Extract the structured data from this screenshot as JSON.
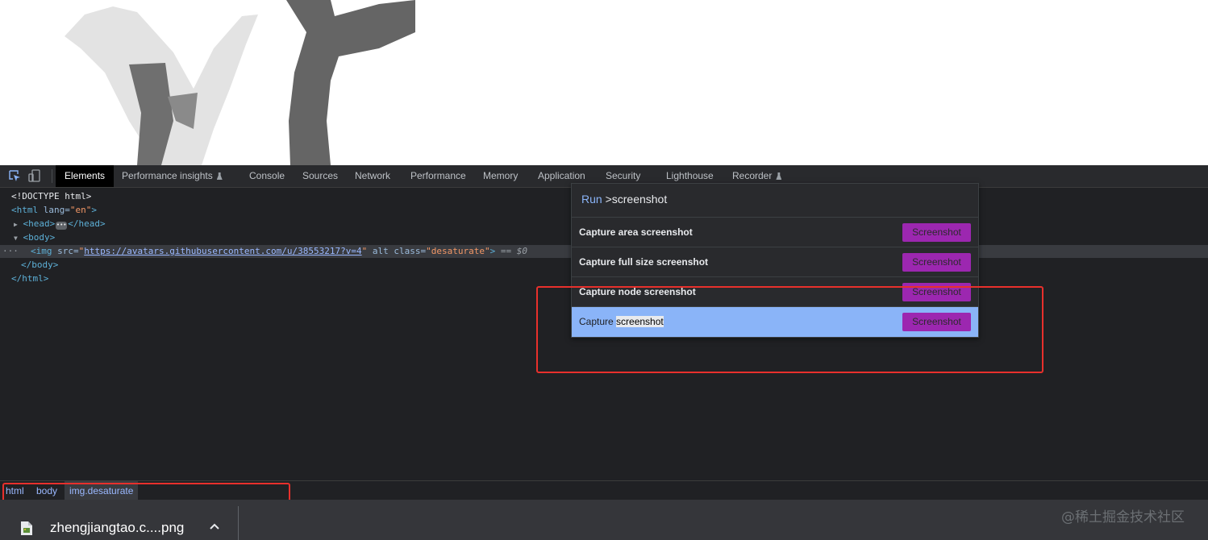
{
  "devtools": {
    "tabs": [
      {
        "label": "Elements",
        "active": true
      },
      {
        "label": "Performance insights",
        "experimental": true
      },
      {
        "label": "Console"
      },
      {
        "label": "Sources"
      },
      {
        "label": "Network"
      },
      {
        "label": "Performance"
      },
      {
        "label": "Memory"
      },
      {
        "label": "Application"
      },
      {
        "label": "Security"
      },
      {
        "label": "Lighthouse"
      },
      {
        "label": "Recorder",
        "experimental": true
      }
    ],
    "icons": [
      "inspect-element-icon",
      "device-toolbar-icon",
      "flask-icon"
    ],
    "dom": {
      "doctype": "<!DOCTYPE html>",
      "html_open": "<html",
      "html_lang_attr": "lang",
      "html_lang_val": "\"en\"",
      "head_open": "<head>",
      "head_close": "</head>",
      "body_open": "<body>",
      "img_open": "<img",
      "img_src_attr": "src",
      "img_src": "https://avatars.githubusercontent.com/u/38553217?v=4",
      "img_alt_attr": "alt",
      "img_class_attr": "class",
      "img_class_val": "\"desaturate\"",
      "selected_marker": "== $0",
      "body_close": "</body>",
      "html_close": "</html>"
    },
    "breadcrumbs": [
      "html",
      "body",
      "img.desaturate"
    ]
  },
  "command_menu": {
    "prefix": "Run",
    "query": ">screenshot",
    "items": [
      {
        "label_plain": "Capture area ",
        "label_match": "screenshot",
        "badge": "Screenshot"
      },
      {
        "label_plain": "Capture full size ",
        "label_match": "screenshot",
        "badge": "Screenshot"
      },
      {
        "label_plain": "Capture node ",
        "label_match": "screenshot",
        "badge": "Screenshot"
      },
      {
        "label_plain": "Capture ",
        "label_match": "screenshot",
        "badge": "Screenshot",
        "highlighted": true
      }
    ]
  },
  "download": {
    "file_name": "zhengjiangtao.c....png",
    "icons": [
      "file-image-icon",
      "chevron-up-icon"
    ]
  },
  "watermark": "@稀土掘金技术社区",
  "colors": {
    "devtools_bg": "#202124",
    "tabbar_bg": "#292a2d",
    "highlight": "#8ab4f8",
    "badge": "#9c27b0",
    "annotation_red": "#e8302c",
    "download_bar": "#35363a"
  }
}
